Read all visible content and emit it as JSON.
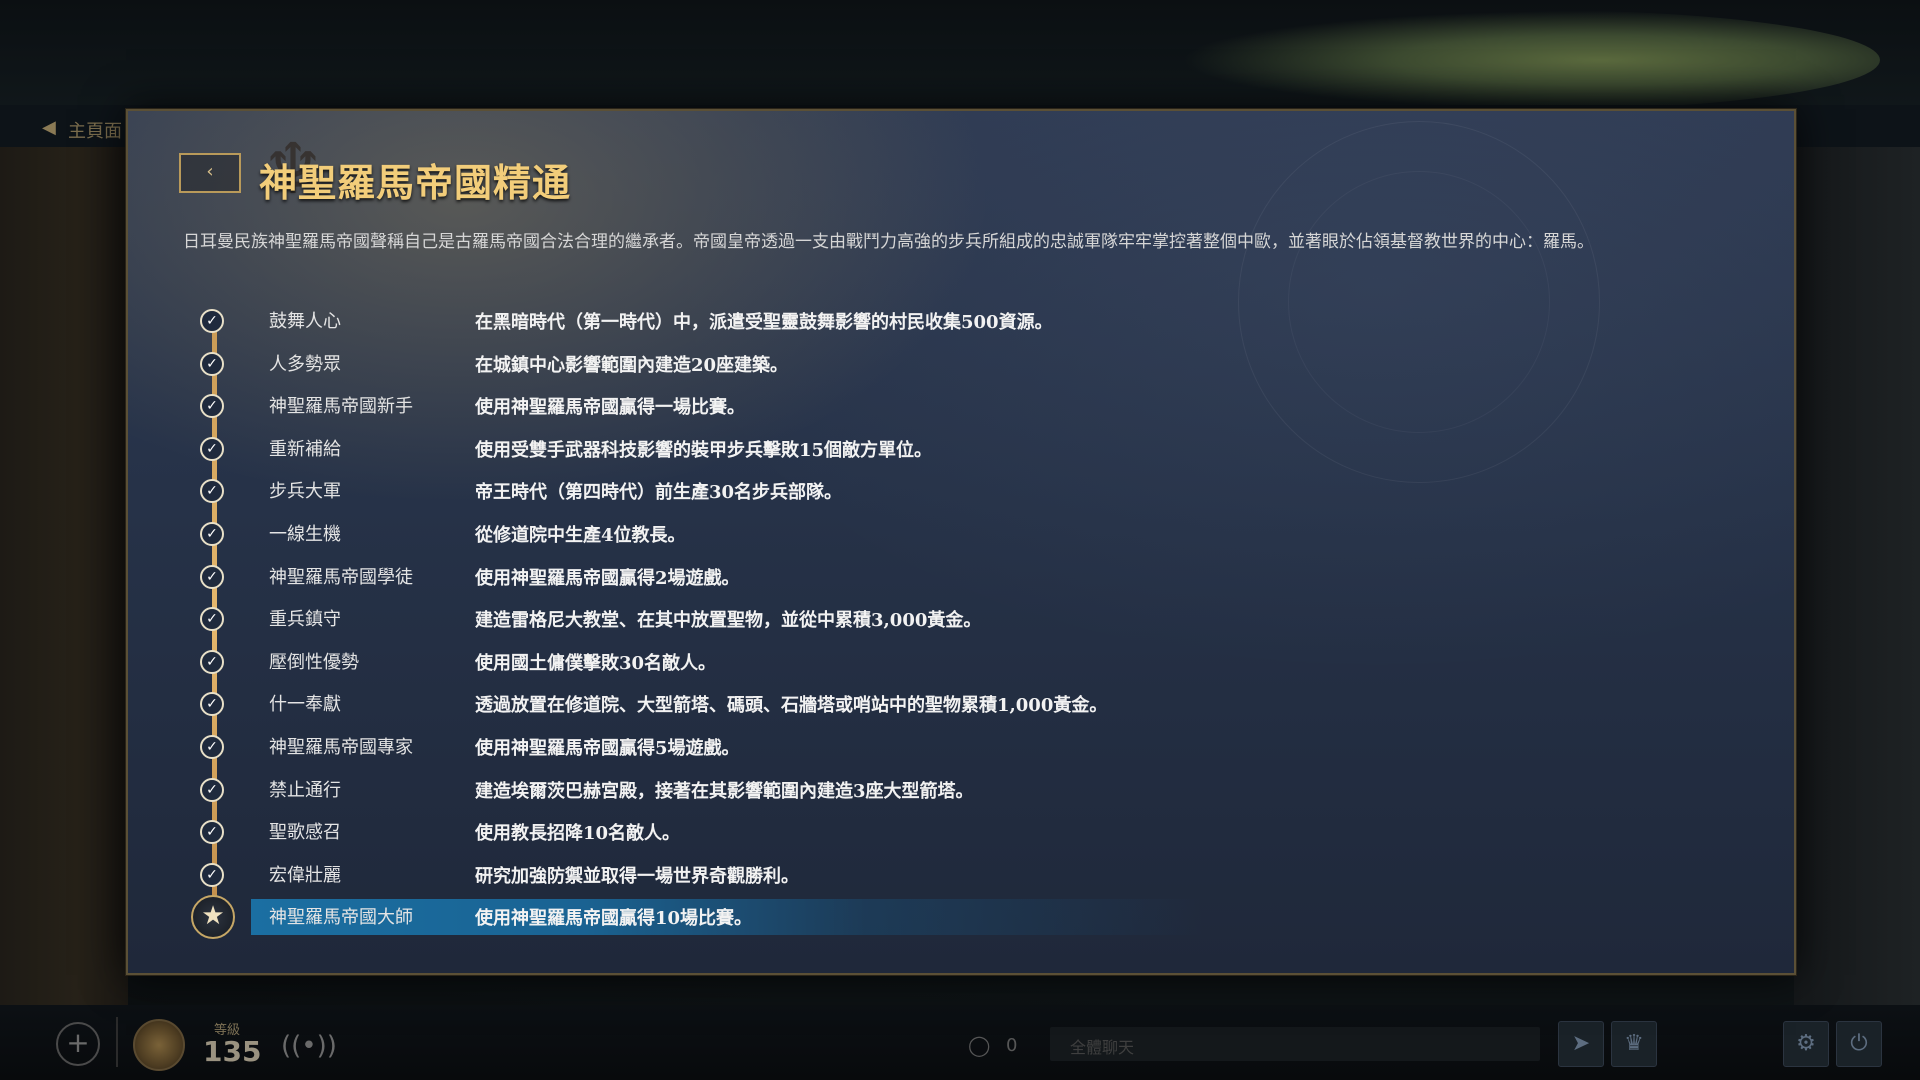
{
  "background": {
    "breadcrumb": "主頁面"
  },
  "panel": {
    "back_icon": "‹",
    "title": "神聖羅馬帝國精通",
    "description": "日耳曼民族神聖羅馬帝國聲稱自己是古羅馬帝國合法合理的繼承者。帝國皇帝透過一支由戰鬥力高強的步兵所組成的忠誠軍隊牢牢掌控著整個中歐，並著眼於佔領基督教世界的中心：羅馬。"
  },
  "achievements": [
    {
      "name": "鼓舞人心",
      "requirement": "在黑暗時代（第一時代）中，派遣受聖靈鼓舞影響的村民收集500資源。",
      "status": "completed"
    },
    {
      "name": "人多勢眾",
      "requirement": "在城鎮中心影響範圍內建造20座建築。",
      "status": "completed"
    },
    {
      "name": "神聖羅馬帝國新手",
      "requirement": "使用神聖羅馬帝國贏得一場比賽。",
      "status": "completed"
    },
    {
      "name": "重新補給",
      "requirement": "使用受雙手武器科技影響的裝甲步兵擊敗15個敵方單位。",
      "status": "completed"
    },
    {
      "name": "步兵大軍",
      "requirement": "帝王時代（第四時代）前生產30名步兵部隊。",
      "status": "completed"
    },
    {
      "name": "一線生機",
      "requirement": "從修道院中生產4位教長。",
      "status": "completed"
    },
    {
      "name": "神聖羅馬帝國學徒",
      "requirement": "使用神聖羅馬帝國贏得2場遊戲。",
      "status": "completed"
    },
    {
      "name": "重兵鎮守",
      "requirement": "建造雷格尼大教堂、在其中放置聖物，並從中累積3,000黃金。",
      "status": "completed"
    },
    {
      "name": "壓倒性優勢",
      "requirement": "使用國土傭僕擊敗30名敵人。",
      "status": "completed"
    },
    {
      "name": "什一奉獻",
      "requirement": "透過放置在修道院、大型箭塔、碼頭、石牆塔或哨站中的聖物累積1,000黃金。",
      "status": "completed"
    },
    {
      "name": "神聖羅馬帝國專家",
      "requirement": "使用神聖羅馬帝國贏得5場遊戲。",
      "status": "completed"
    },
    {
      "name": "禁止通行",
      "requirement": "建造埃爾茨巴赫宮殿，接著在其影響範圍內建造3座大型箭塔。",
      "status": "completed"
    },
    {
      "name": "聖歌感召",
      "requirement": "使用教長招降10名敵人。",
      "status": "completed"
    },
    {
      "name": "宏偉壯麗",
      "requirement": "研究加強防禦並取得一場世界奇觀勝利。",
      "status": "completed"
    },
    {
      "name": "神聖羅馬帝國大師",
      "requirement": "使用神聖羅馬帝國贏得10場比賽。",
      "status": "highlighted"
    }
  ],
  "icons": {
    "check": "✓",
    "star": "★",
    "plus": "+",
    "wifi": "📶"
  },
  "bottombar": {
    "level_label": "等級",
    "level_value": "135",
    "online_count": "0",
    "chat_placeholder": "全體聊天"
  },
  "colors": {
    "title_gold": "#f2cd7a",
    "highlight_blue": "#1b6fa2",
    "timeline_gold": "#e6b86d"
  }
}
